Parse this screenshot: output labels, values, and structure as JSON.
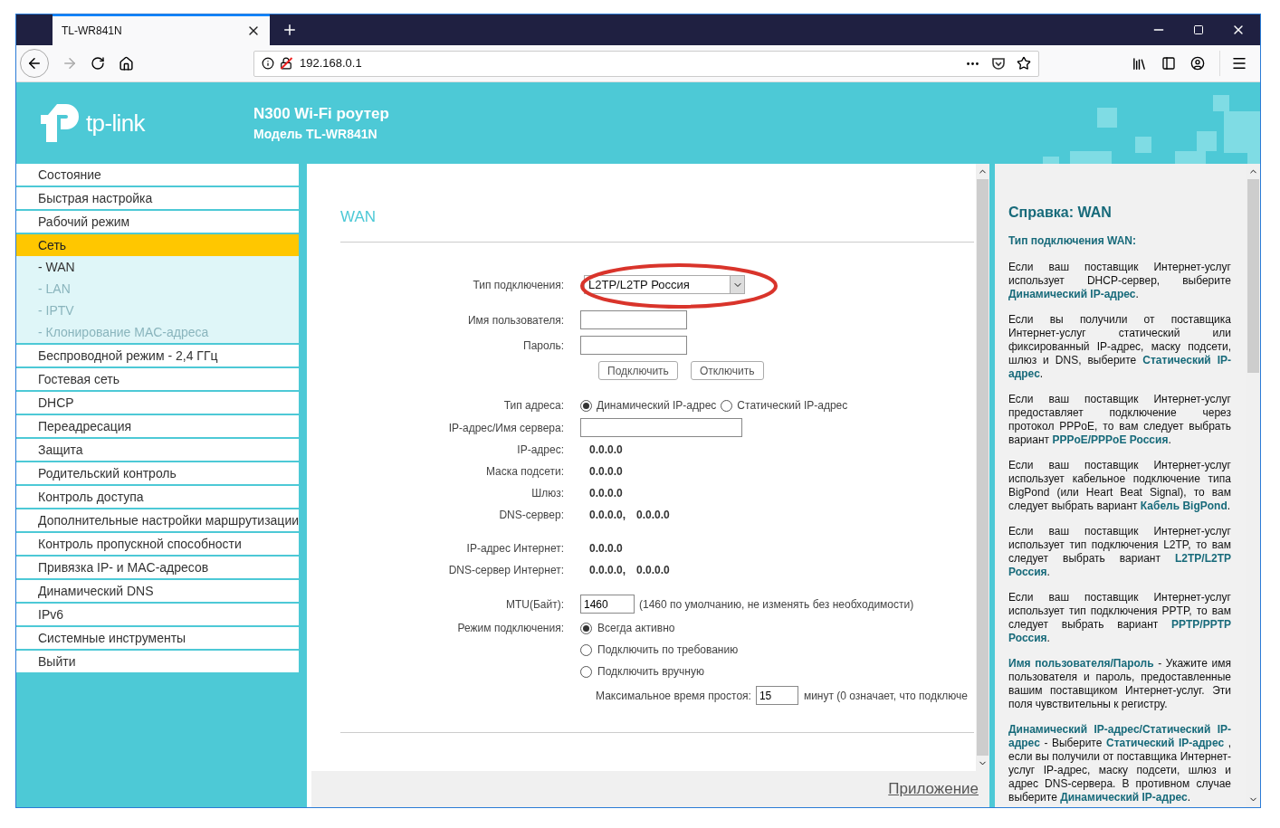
{
  "browser": {
    "tab_title": "TL-WR841N",
    "url": "192.168.0.1"
  },
  "header": {
    "logo_text": "tp-link",
    "title": "N300 Wi-Fi роутер",
    "subtitle": "Модель TL-WR841N"
  },
  "sidebar": {
    "items": [
      {
        "label": "Состояние",
        "selected": false
      },
      {
        "label": "Быстрая настройка",
        "selected": false
      },
      {
        "label": "Рабочий режим",
        "selected": false
      },
      {
        "label": "Сеть",
        "selected": true,
        "children": [
          {
            "label": "- WAN",
            "selected": true
          },
          {
            "label": "- LAN",
            "selected": false
          },
          {
            "label": "- IPTV",
            "selected": false
          },
          {
            "label": "- Клонирование MAC-адреса",
            "selected": false
          }
        ]
      },
      {
        "label": "Беспроводной режим - 2,4 ГГц",
        "selected": false
      },
      {
        "label": "Гостевая сеть",
        "selected": false
      },
      {
        "label": "DHCP",
        "selected": false
      },
      {
        "label": "Переадресация",
        "selected": false
      },
      {
        "label": "Защита",
        "selected": false
      },
      {
        "label": "Родительский контроль",
        "selected": false
      },
      {
        "label": "Контроль доступа",
        "selected": false
      },
      {
        "label": "Дополнительные настройки маршрутизации",
        "selected": false
      },
      {
        "label": "Контроль пропускной способности",
        "selected": false
      },
      {
        "label": "Привязка IP- и MAC-адресов",
        "selected": false
      },
      {
        "label": "Динамический DNS",
        "selected": false
      },
      {
        "label": "IPv6",
        "selected": false
      },
      {
        "label": "Системные инструменты",
        "selected": false
      },
      {
        "label": "Выйти",
        "selected": false
      }
    ]
  },
  "main": {
    "title": "WAN",
    "connection_type": {
      "label": "Тип подключения:",
      "value": "L2TP/L2TP Россия",
      "highlighted": true
    },
    "username": {
      "label": "Имя пользователя:"
    },
    "password": {
      "label": "Пароль:"
    },
    "buttons": [
      "Подключить",
      "Отключить"
    ],
    "address_type": {
      "label": "Тип адреса:",
      "options": [
        {
          "label": "Динамический IP-адрес",
          "selected": true
        },
        {
          "label": "Статический IP-адрес",
          "selected": false
        }
      ]
    },
    "server": {
      "label": "IP-адрес/Имя сервера:"
    },
    "status_groups": [
      [
        {
          "label": "IP-адрес:",
          "values": [
            "0.0.0.0"
          ]
        },
        {
          "label": "Маска подсети:",
          "values": [
            "0.0.0.0"
          ]
        },
        {
          "label": "Шлюз:",
          "values": [
            "0.0.0.0"
          ]
        },
        {
          "label": "DNS-сервер:",
          "values": [
            "0.0.0.0,",
            "0.0.0.0"
          ]
        }
      ],
      [
        {
          "label": "IP-адрес Интернет:",
          "values": [
            "0.0.0.0"
          ]
        },
        {
          "label": "DNS-сервер Интернет:",
          "values": [
            "0.0.0.0,",
            "0.0.0.0"
          ]
        }
      ]
    ],
    "mtu": {
      "label": "MTU(Байт):",
      "value": "1460",
      "note": "(1460 по умолчанию, не изменять без необходимости)"
    },
    "mode": {
      "label": "Режим подключения:",
      "options": [
        {
          "label": "Всегда активно",
          "selected": true
        },
        {
          "label": "Подключить по требованию",
          "selected": false
        },
        {
          "label": "Подключить вручную",
          "selected": false
        }
      ]
    },
    "idle": {
      "label": "Максимальное время простоя:",
      "value": "15",
      "note": "минут (0 означает, что подключе"
    },
    "footer_link": "Приложение"
  },
  "help": {
    "title": "Справка: WAN",
    "subtitle": "Тип подключения WAN:",
    "paragraphs": [
      "Если ваш поставщик Интернет-услуг использует DHCP-сервер, выберите **Динамический IP-адрес**.",
      "Если вы получили от поставщика Интернет-услуг статический или фиксированный IP-адрес, маску подсети, шлюз и DNS, выберите **Статический IP-адрес**.",
      "Если ваш поставщик Интернет-услуг предоставляет подключение через протокол PPPoE, то вам следует выбрать вариант **PPPoE/PPPoE Россия**.",
      "Если ваш поставщик Интернет-услуг использует кабельное подключение типа BigPond (или Heart Beat Signal), то вам следует выбрать вариант **Кабель BigPond**.",
      "Если ваш поставщик Интернет-услуг использует тип подключения L2TP, то вам следует выбрать вариант **L2TP/L2TP Россия**.",
      "Если ваш поставщик Интернет-услуг использует тип подключения PPTP, то вам следует выбрать вариант **PPTP/PPTP Россия**.",
      "**Имя пользователя/Пароль** - Укажите имя пользователя и пароль, предоставленные вашим поставщиком Интернет-услуг. Эти поля чувствительны к регистру.",
      "**Динамический IP-адрес/Статический IP-адрес** - Выберите **Статический IP-адрес** , если вы получили от поставщика Интернет-услуг IP-адрес, маску подсети, шлюз и адрес DNS-сервера. В противном случае выберите **Динамический IP-адрес**."
    ]
  }
}
